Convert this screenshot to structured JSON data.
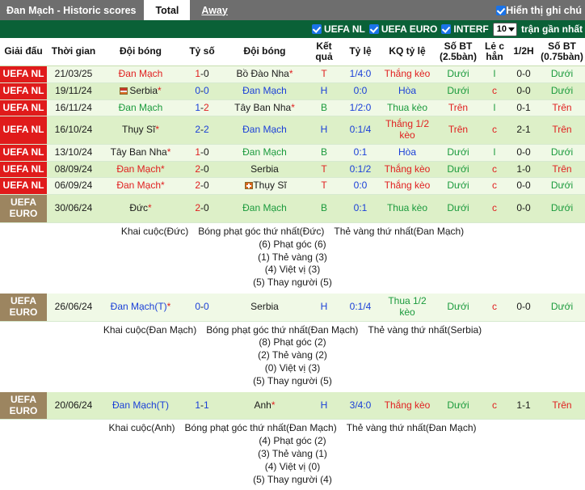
{
  "header": {
    "title": "Đan Mạch - Historic scores",
    "tabs": [
      {
        "label": "Total",
        "active": true
      },
      {
        "label": "Away",
        "active": false
      }
    ],
    "show_notes_label": "Hiển thị ghi chú",
    "show_notes_checked": true
  },
  "filters": {
    "items": [
      {
        "label": "UEFA NL",
        "checked": true
      },
      {
        "label": "UEFA EURO",
        "checked": true
      },
      {
        "label": "INTERF",
        "checked": true
      }
    ],
    "match_count": "10",
    "match_count_suffix": "trận gần nhất"
  },
  "colors": {
    "topbar": "#6e6e6e",
    "filterbar": "#0a6137",
    "league_nl": "#e01b1b",
    "league_euro": "#9c8560",
    "row_light": "#f0f9e6",
    "row_dark": "#ddf0c8",
    "accent_checkbox": "#1a73e8",
    "red_text": "#e02020",
    "green_text": "#1a9a3c",
    "blue_text": "#1a3fd8"
  },
  "table": {
    "columns": [
      "Giải đấu",
      "Thời gian",
      "Đội bóng",
      "Tỷ số",
      "Đội bóng",
      "Kết quả",
      "Tỷ lệ",
      "KQ tỷ lệ",
      "Số BT (2.5bàn)",
      "Lẻ c hẳn",
      "1/2H",
      "Số BT (0.75bàn)"
    ],
    "rows": [
      {
        "league": "UEFA NL",
        "league_type": "nl",
        "date": "21/03/25",
        "home": "Đan Mạch",
        "home_color": "red",
        "home_star": false,
        "home_flag": "",
        "score": "1-0",
        "score_colors": [
          "red",
          "black"
        ],
        "away": "Bồ Đào Nha",
        "away_color": "black",
        "away_star": true,
        "away_flag": "",
        "result": "T",
        "result_color": "red",
        "odds": "1/4:0",
        "odds_color": "blue",
        "odds_result": "Thắng kèo",
        "odds_result_color": "red",
        "ou": "Dưới",
        "ou_color": "green",
        "oddeven": "l",
        "oddeven_color": "green",
        "half": "0-0",
        "half_color": "black",
        "ou2": "Dưới",
        "ou2_color": "green"
      },
      {
        "league": "UEFA NL",
        "league_type": "nl",
        "date": "19/11/24",
        "home": "Serbia",
        "home_color": "black",
        "home_star": true,
        "home_flag": "serbia",
        "score": "0-0",
        "score_colors": [
          "blue",
          "blue"
        ],
        "away": "Đan Mạch",
        "away_color": "blue",
        "away_star": false,
        "away_flag": "",
        "result": "H",
        "result_color": "blue",
        "odds": "0:0",
        "odds_color": "blue",
        "odds_result": "Hòa",
        "odds_result_color": "blue",
        "ou": "Dưới",
        "ou_color": "green",
        "oddeven": "c",
        "oddeven_color": "red",
        "half": "0-0",
        "half_color": "black",
        "ou2": "Dưới",
        "ou2_color": "green"
      },
      {
        "league": "UEFA NL",
        "league_type": "nl",
        "date": "16/11/24",
        "home": "Đan Mạch",
        "home_color": "green",
        "home_star": false,
        "home_flag": "",
        "score": "1-2",
        "score_colors": [
          "blue",
          "red"
        ],
        "away": "Tây Ban Nha",
        "away_color": "black",
        "away_star": true,
        "away_flag": "",
        "result": "B",
        "result_color": "green",
        "odds": "1/2:0",
        "odds_color": "blue",
        "odds_result": "Thua kèo",
        "odds_result_color": "green",
        "ou": "Trên",
        "ou_color": "red",
        "oddeven": "l",
        "oddeven_color": "green",
        "half": "0-1",
        "half_color": "black",
        "ou2": "Trên",
        "ou2_color": "red"
      },
      {
        "league": "UEFA NL",
        "league_type": "nl",
        "date": "16/10/24",
        "home": "Thụy Sĩ",
        "home_color": "black",
        "home_star": true,
        "home_flag": "",
        "score": "2-2",
        "score_colors": [
          "blue",
          "blue"
        ],
        "away": "Đan Mạch",
        "away_color": "blue",
        "away_star": false,
        "away_flag": "",
        "result": "H",
        "result_color": "blue",
        "odds": "0:1/4",
        "odds_color": "blue",
        "odds_result": "Thắng 1/2 kèo",
        "odds_result_color": "red",
        "ou": "Trên",
        "ou_color": "red",
        "oddeven": "c",
        "oddeven_color": "red",
        "half": "2-1",
        "half_color": "black",
        "ou2": "Trên",
        "ou2_color": "red"
      },
      {
        "league": "UEFA NL",
        "league_type": "nl",
        "date": "13/10/24",
        "home": "Tây Ban Nha",
        "home_color": "black",
        "home_star": true,
        "home_flag": "",
        "score": "1-0",
        "score_colors": [
          "red",
          "black"
        ],
        "away": "Đan Mạch",
        "away_color": "green",
        "away_star": false,
        "away_flag": "",
        "result": "B",
        "result_color": "green",
        "odds": "0:1",
        "odds_color": "blue",
        "odds_result": "Hòa",
        "odds_result_color": "blue",
        "ou": "Dưới",
        "ou_color": "green",
        "oddeven": "l",
        "oddeven_color": "green",
        "half": "0-0",
        "half_color": "black",
        "ou2": "Dưới",
        "ou2_color": "green"
      },
      {
        "league": "UEFA NL",
        "league_type": "nl",
        "date": "08/09/24",
        "home": "Đan Mạch",
        "home_color": "red",
        "home_star": true,
        "home_flag": "",
        "score": "2-0",
        "score_colors": [
          "red",
          "black"
        ],
        "away": "Serbia",
        "away_color": "black",
        "away_star": false,
        "away_flag": "",
        "result": "T",
        "result_color": "red",
        "odds": "0:1/2",
        "odds_color": "blue",
        "odds_result": "Thắng kèo",
        "odds_result_color": "red",
        "ou": "Dưới",
        "ou_color": "green",
        "oddeven": "c",
        "oddeven_color": "red",
        "half": "1-0",
        "half_color": "black",
        "ou2": "Trên",
        "ou2_color": "red"
      },
      {
        "league": "UEFA NL",
        "league_type": "nl",
        "date": "06/09/24",
        "home": "Đan Mạch",
        "home_color": "red",
        "home_star": true,
        "home_flag": "",
        "score": "2-0",
        "score_colors": [
          "red",
          "black"
        ],
        "away": "Thụy Sĩ",
        "away_color": "black",
        "away_star": false,
        "away_flag": "swiss",
        "result": "T",
        "result_color": "red",
        "odds": "0:0",
        "odds_color": "blue",
        "odds_result": "Thắng kèo",
        "odds_result_color": "red",
        "ou": "Dưới",
        "ou_color": "green",
        "oddeven": "c",
        "oddeven_color": "red",
        "half": "0-0",
        "half_color": "black",
        "ou2": "Dưới",
        "ou2_color": "green"
      },
      {
        "league": "UEFA EURO",
        "league_type": "euro",
        "date": "30/06/24",
        "home": "Đức",
        "home_color": "black",
        "home_star": true,
        "home_flag": "",
        "score": "2-0",
        "score_colors": [
          "red",
          "black"
        ],
        "away": "Đan Mạch",
        "away_color": "green",
        "away_star": false,
        "away_flag": "",
        "result": "B",
        "result_color": "green",
        "odds": "0:1",
        "odds_color": "blue",
        "odds_result": "Thua kèo",
        "odds_result_color": "green",
        "ou": "Dưới",
        "ou_color": "green",
        "oddeven": "c",
        "oddeven_color": "red",
        "half": "0-0",
        "half_color": "black",
        "ou2": "Dưới",
        "ou2_color": "green",
        "detail": {
          "head": [
            "Khai cuộc(Đức)",
            "Bóng phạt góc thứ nhất(Đức)",
            "Thẻ vàng thứ nhất(Đan Mạch)"
          ],
          "lines": [
            "(6) Phạt góc (6)",
            "(1) Thẻ vàng (3)",
            "(4) Việt vị (3)",
            "(5) Thay người (5)"
          ]
        }
      },
      {
        "league": "UEFA EURO",
        "league_type": "euro",
        "date": "26/06/24",
        "home": "Đan Mạch(T)",
        "home_color": "blue",
        "home_star": true,
        "home_flag": "",
        "score": "0-0",
        "score_colors": [
          "blue",
          "blue"
        ],
        "away": "Serbia",
        "away_color": "black",
        "away_star": false,
        "away_flag": "",
        "result": "H",
        "result_color": "blue",
        "odds": "0:1/4",
        "odds_color": "blue",
        "odds_result": "Thua 1/2 kèo",
        "odds_result_color": "green",
        "ou": "Dưới",
        "ou_color": "green",
        "oddeven": "c",
        "oddeven_color": "red",
        "half": "0-0",
        "half_color": "black",
        "ou2": "Dưới",
        "ou2_color": "green",
        "detail": {
          "head": [
            "Khai cuộc(Đan Mạch)",
            "Bóng phạt góc thứ nhất(Đan Mạch)",
            "Thẻ vàng thứ nhất(Serbia)"
          ],
          "lines": [
            "(8) Phạt góc (2)",
            "(2) Thẻ vàng (2)",
            "(0) Việt vị (3)",
            "(5) Thay người (5)"
          ]
        }
      },
      {
        "league": "UEFA EURO",
        "league_type": "euro",
        "date": "20/06/24",
        "home": "Đan Mạch(T)",
        "home_color": "blue",
        "home_star": false,
        "home_flag": "",
        "score": "1-1",
        "score_colors": [
          "blue",
          "blue"
        ],
        "away": "Anh",
        "away_color": "black",
        "away_star": true,
        "away_flag": "",
        "result": "H",
        "result_color": "blue",
        "odds": "3/4:0",
        "odds_color": "blue",
        "odds_result": "Thắng kèo",
        "odds_result_color": "red",
        "ou": "Dưới",
        "ou_color": "green",
        "oddeven": "c",
        "oddeven_color": "red",
        "half": "1-1",
        "half_color": "black",
        "ou2": "Trên",
        "ou2_color": "red",
        "detail": {
          "head": [
            "Khai cuộc(Anh)",
            "Bóng phạt góc thứ nhất(Đan Mạch)",
            "Thẻ vàng thứ nhất(Đan Mạch)"
          ],
          "lines": [
            "(4) Phạt góc (2)",
            "(3) Thẻ vàng (1)",
            "(4) Việt vị (0)",
            "(5) Thay người (4)"
          ]
        }
      }
    ]
  }
}
